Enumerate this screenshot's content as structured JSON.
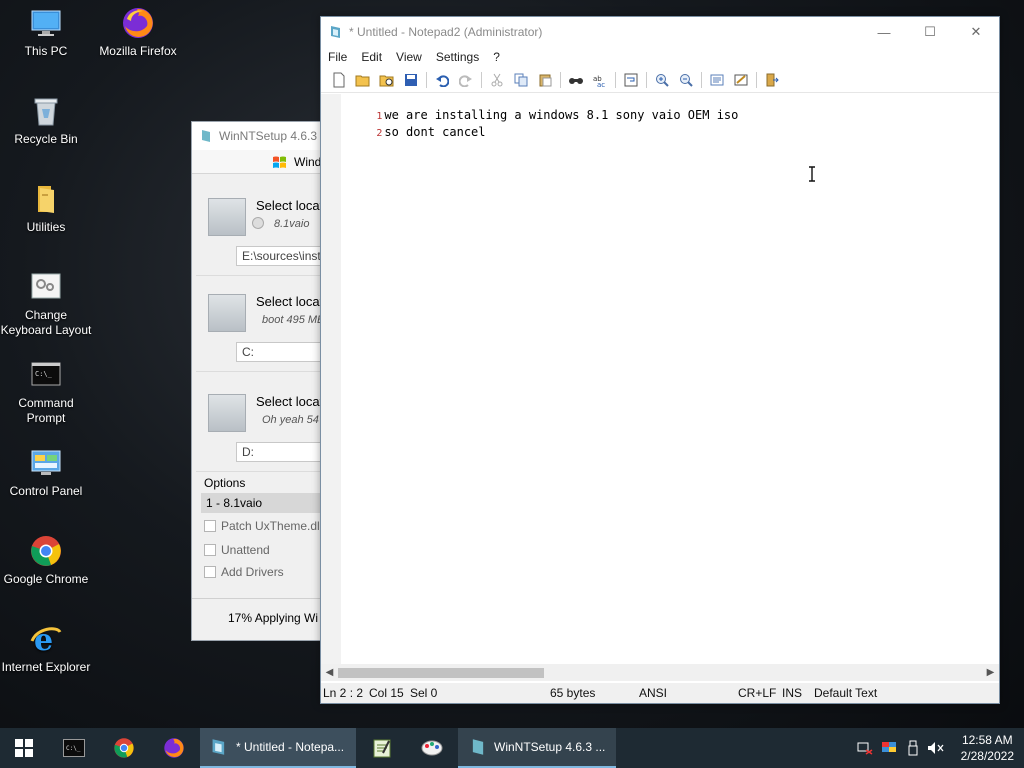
{
  "desktop": {
    "icons": [
      {
        "label": "This PC",
        "icon": "this-pc-icon"
      },
      {
        "label": "Mozilla Firefox",
        "icon": "firefox-icon"
      },
      {
        "label": "Recycle Bin",
        "icon": "recycle-bin-icon"
      },
      {
        "label": "Utilities",
        "icon": "folder-icon"
      },
      {
        "label": "Change Keyboard Layout",
        "icon": "keyboard-layout-icon"
      },
      {
        "label": "Command Prompt",
        "icon": "command-prompt-icon"
      },
      {
        "label": "Control Panel",
        "icon": "control-panel-icon"
      },
      {
        "label": "Google Chrome",
        "icon": "chrome-icon"
      },
      {
        "label": "Internet Explorer",
        "icon": "internet-explorer-icon"
      }
    ]
  },
  "winntsetup": {
    "title": "WinNTSetup 4.6.3",
    "tab_label": "Wind",
    "sections": [
      {
        "title": "Select locat",
        "sub": "8.1vaio",
        "field": "E:\\sources\\inst"
      },
      {
        "title": "Select locat",
        "sub": "boot 495 ME",
        "field": "C:"
      },
      {
        "title": "Select locat",
        "sub": "Oh yeah 54",
        "field": "D:"
      }
    ],
    "options_title": "Options",
    "selected_option": "1 - 8.1vaio",
    "checkboxes": [
      "Patch UxTheme.dll",
      "Unattend",
      "Add Drivers"
    ],
    "status": "17% Applying Wi"
  },
  "notepad": {
    "title": "* Untitled - Notepad2 (Administrator)",
    "menu": [
      "File",
      "Edit",
      "View",
      "Settings",
      "?"
    ],
    "lines": [
      {
        "num": "1",
        "text": "we are installing a windows 8.1 sony vaio OEM iso"
      },
      {
        "num": "2",
        "text": "so dont cancel"
      }
    ],
    "status": {
      "position": "Ln 2 : 2",
      "column": "Col 15",
      "selection": "Sel 0",
      "size": "65 bytes",
      "encoding": "ANSI",
      "line_endings": "CR+LF",
      "mode": "INS",
      "scheme": "Default Text"
    }
  },
  "taskbar": {
    "items": [
      {
        "label": "* Untitled - Notepa...",
        "icon": "notepad2-icon"
      },
      {
        "label": "WinNTSetup 4.6.3 ...",
        "icon": "winntsetup-icon"
      }
    ],
    "clock_time": "12:58 AM",
    "clock_date": "2/28/2022"
  },
  "colors": {
    "taskbar": "#1e2a33",
    "active_task": "#3d4f5d",
    "accent": "#7fb8e0"
  }
}
